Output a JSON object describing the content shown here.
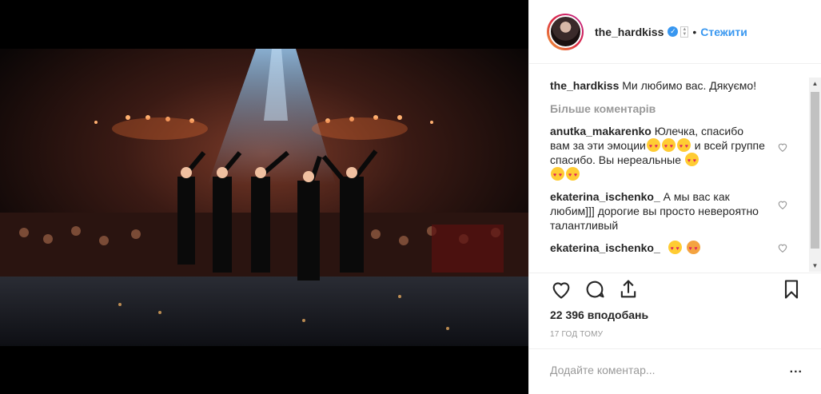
{
  "post": {
    "username": "the_hardkiss",
    "follow_label": "Стежити",
    "caption_user": "the_hardkiss",
    "caption_text": "Ми любимо вас. Дякуємо!",
    "more_comments": "Більше коментарів",
    "comments": [
      {
        "user": "anutka_makarenko",
        "text_a": "Юлечка, спасибо вам за эти эмоции",
        "text_b": " и всей группе спасибо. Вы нереальные "
      },
      {
        "user": "ekaterina_ischenko_",
        "text": "А мы вас как любим]]] дорогие вы просто невероятно талантливый"
      },
      {
        "user": "ekaterina_ischenko_",
        "text": ""
      }
    ],
    "likes": "22 396 вподобань",
    "time": "17 ГОД ТОМУ",
    "comment_placeholder": "Додайте коментар...",
    "ellipsis": "..."
  },
  "icons": [
    "verified-badge-icon",
    "heart-icon",
    "comment-icon",
    "share-icon",
    "bookmark-icon",
    "small-heart-icon"
  ],
  "colors": {
    "accent": "#3897f0",
    "muted": "#999999",
    "text": "#262626"
  }
}
